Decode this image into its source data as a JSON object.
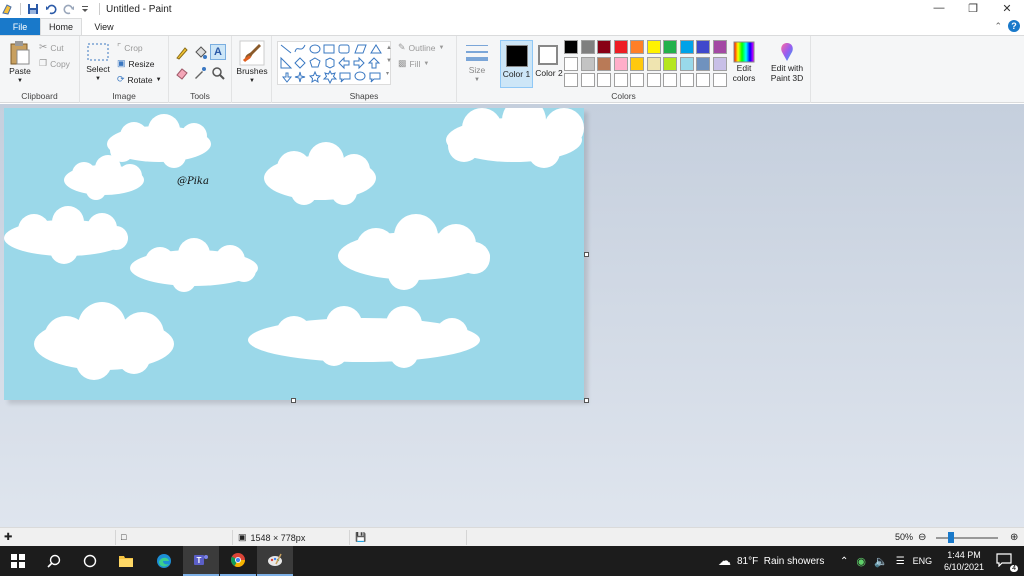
{
  "window": {
    "title": "Untitled - Paint",
    "controls": [
      "minimize-icon",
      "restore-icon",
      "close-icon"
    ]
  },
  "tabs": {
    "file": "File",
    "home": "Home",
    "view": "View"
  },
  "ribbon": {
    "clipboard": {
      "label": "Clipboard",
      "paste": "Paste",
      "cut": "Cut",
      "copy": "Copy"
    },
    "image": {
      "label": "Image",
      "select": "Select",
      "crop": "Crop",
      "resize": "Resize",
      "rotate": "Rotate"
    },
    "tools": {
      "label": "Tools"
    },
    "brushes": {
      "label": "Brushes"
    },
    "shapes": {
      "label": "Shapes",
      "outline": "Outline",
      "fill": "Fill"
    },
    "size": {
      "label": "Size"
    },
    "colors": {
      "label": "Colors",
      "color1": "Color 1",
      "color2": "Color 2",
      "edit_colors": "Edit colors",
      "edit_paint3d": "Edit with Paint 3D",
      "color1_value": "#000000",
      "color2_value": "#ffffff",
      "palette_row1": [
        "#000000",
        "#7f7f7f",
        "#880015",
        "#ed1c24",
        "#ff7f27",
        "#fff200",
        "#22b14c",
        "#00a2e8",
        "#3f48cc",
        "#a349a4"
      ],
      "palette_row2": [
        "#ffffff",
        "#c3c3c3",
        "#b97a57",
        "#ffaec9",
        "#ffc90e",
        "#efe4b0",
        "#b5e61d",
        "#99d9ea",
        "#7092be",
        "#c8bfe7"
      ],
      "palette_row3": [
        "#ffffff",
        "#ffffff",
        "#ffffff",
        "#ffffff",
        "#ffffff",
        "#ffffff",
        "#ffffff",
        "#ffffff",
        "#ffffff",
        "#ffffff"
      ]
    }
  },
  "canvas": {
    "background": "#9bd8e9",
    "signature": "@Pika"
  },
  "status": {
    "dimensions": "1548 × 778px",
    "zoom": "50%",
    "zoom_fraction": 0.24
  },
  "taskbar": {
    "weather": "81°F  Rain showers",
    "language": "ENG",
    "time": "1:44 PM",
    "date": "6/10/2021",
    "notifications": "4"
  }
}
